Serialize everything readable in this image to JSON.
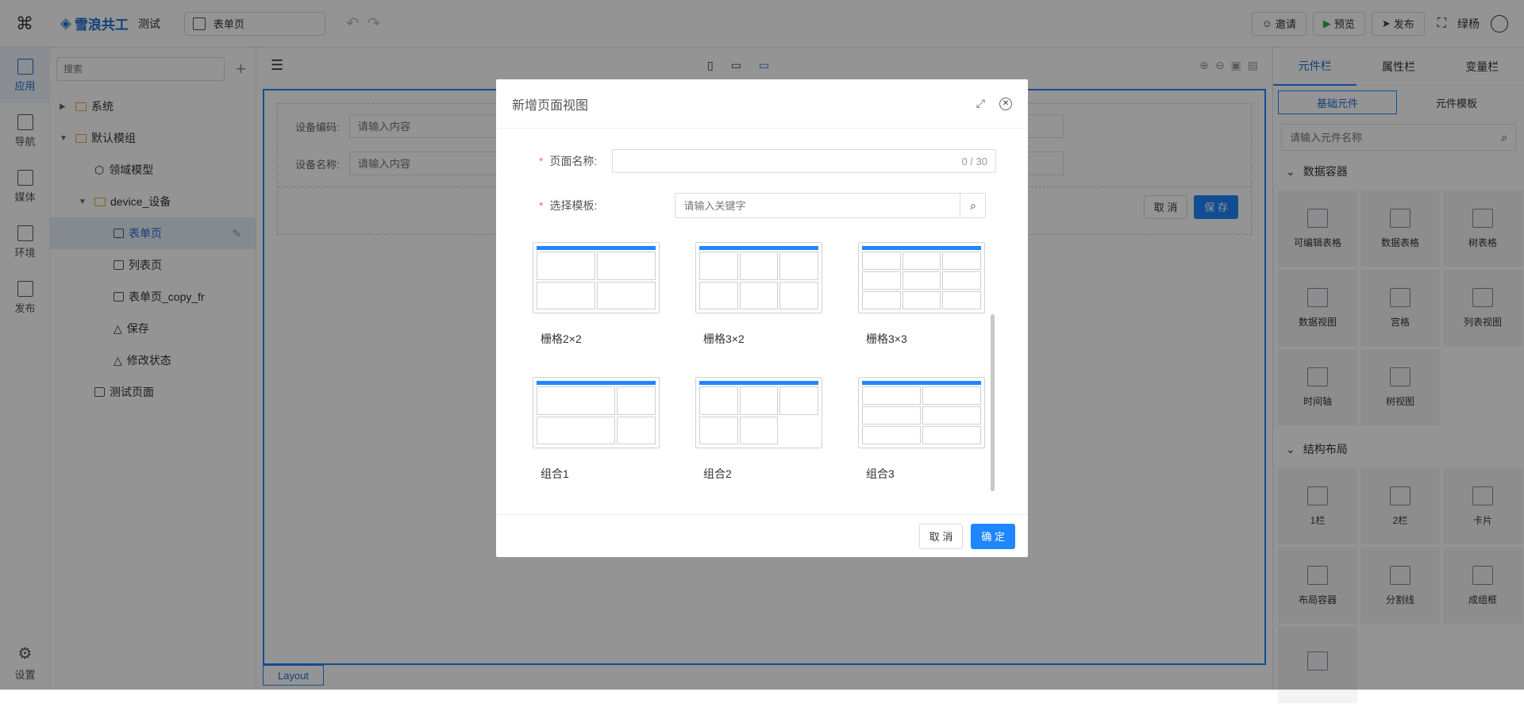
{
  "topbar": {
    "brand": "雪浪共工",
    "project": "测试",
    "page_tab": "表单页",
    "invite": "邀请",
    "preview": "预览",
    "publish": "发布",
    "user": "绿杨"
  },
  "rail": {
    "items": [
      {
        "label": "应用",
        "icon": "app-icon"
      },
      {
        "label": "导航",
        "icon": "nav-icon"
      },
      {
        "label": "媒体",
        "icon": "media-icon"
      },
      {
        "label": "环境",
        "icon": "env-icon"
      },
      {
        "label": "发布",
        "icon": "cube-icon"
      }
    ],
    "settings": "设置"
  },
  "tree": {
    "search_placeholder": "搜索",
    "nodes": [
      {
        "label": "系统",
        "depth": 0,
        "type": "folder",
        "arrow": "right"
      },
      {
        "label": "默认模组",
        "depth": 0,
        "type": "folder",
        "arrow": "down"
      },
      {
        "label": "领域模型",
        "depth": 1,
        "type": "cube"
      },
      {
        "label": "device_设备",
        "depth": 1,
        "type": "folder",
        "arrow": "down"
      },
      {
        "label": "表单页",
        "depth": 2,
        "type": "page",
        "selected": true
      },
      {
        "label": "列表页",
        "depth": 2,
        "type": "page"
      },
      {
        "label": "表单页_copy_fr",
        "depth": 2,
        "type": "page"
      },
      {
        "label": "保存",
        "depth": 2,
        "type": "action"
      },
      {
        "label": "修改状态",
        "depth": 2,
        "type": "action"
      },
      {
        "label": "测试页面",
        "depth": 1,
        "type": "page"
      }
    ]
  },
  "canvas": {
    "field1_label": "设备编码:",
    "field1_placeholder": "请输入内容",
    "field2_label": "设备名称:",
    "field2_placeholder": "请输入内容",
    "cancel": "取 消",
    "save": "保 存",
    "layout_tab": "Layout"
  },
  "right": {
    "tabs": [
      "元件栏",
      "属性栏",
      "变量栏"
    ],
    "subtabs": [
      "基础元件",
      "元件模板"
    ],
    "search_placeholder": "请输入元件名称",
    "sections": [
      {
        "title": "数据容器",
        "items": [
          "可编辑表格",
          "数据表格",
          "树表格",
          "数据视图",
          "宫格",
          "列表视图",
          "时间轴",
          "树视图"
        ]
      },
      {
        "title": "结构布局",
        "items": [
          "1栏",
          "2栏",
          "卡片",
          "布局容器",
          "分割线",
          "成组框",
          ""
        ]
      }
    ]
  },
  "dialog": {
    "title": "新增页面视图",
    "name_label": "页面名称:",
    "name_counter": "0 / 30",
    "template_label": "选择模板:",
    "template_placeholder": "请输入关键字",
    "templates": [
      "栅格2×2",
      "栅格3×2",
      "栅格3×3",
      "组合1",
      "组合2",
      "组合3"
    ],
    "cancel": "取 消",
    "confirm": "确 定"
  },
  "colors": {
    "primary": "#1f86ff",
    "selected_bg": "#e6eef8",
    "required": "#f56c6c"
  }
}
